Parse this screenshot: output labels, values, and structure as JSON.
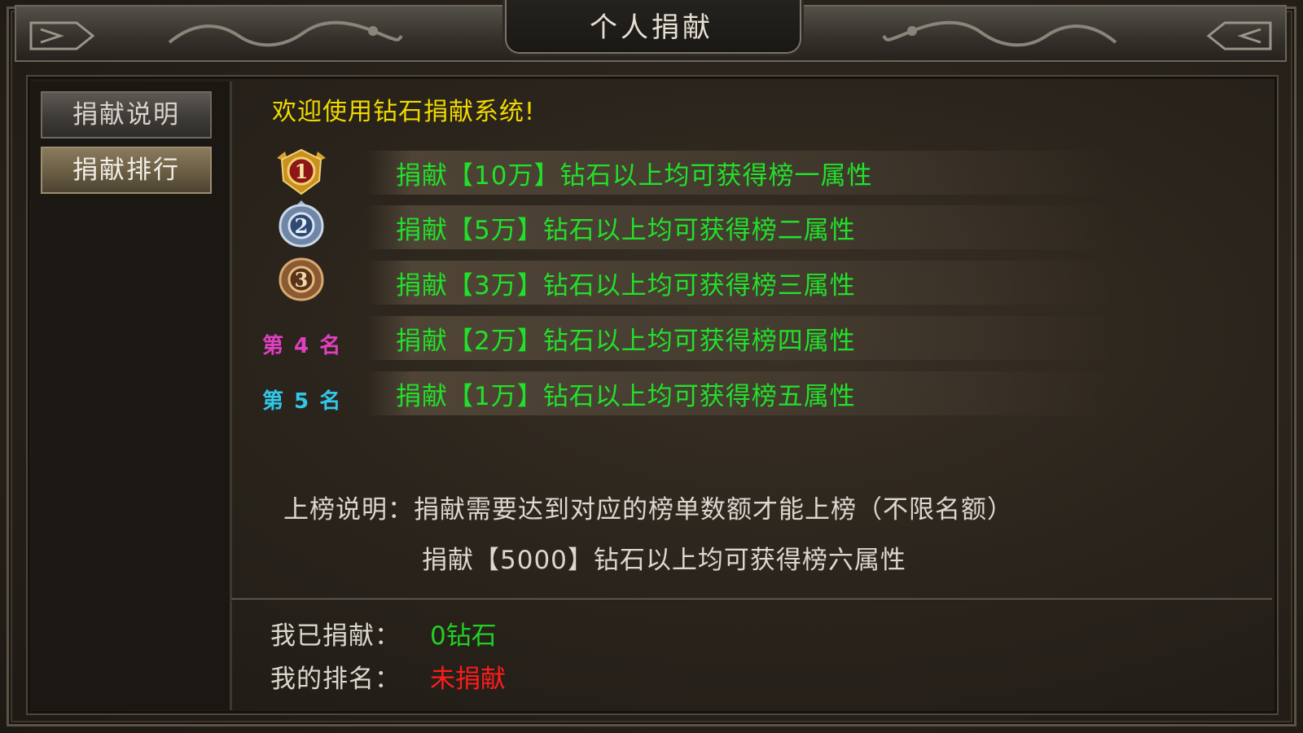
{
  "window": {
    "title": "个人捐献"
  },
  "sidebar": {
    "items": [
      {
        "label": "捐献说明",
        "active": false
      },
      {
        "label": "捐献排行",
        "active": true
      }
    ]
  },
  "main": {
    "welcome": "欢迎使用钻石捐献系统!",
    "tiers": [
      {
        "rank_badge": "1",
        "text": "捐献【10万】钻石以上均可获得榜一属性"
      },
      {
        "rank_badge": "2",
        "text": "捐献【5万】钻石以上均可获得榜二属性"
      },
      {
        "rank_badge": "3",
        "text": "捐献【3万】钻石以上均可获得榜三属性"
      },
      {
        "rank_label": "第 4 名",
        "text": "捐献【2万】钻石以上均可获得榜四属性"
      },
      {
        "rank_label": "第 5 名",
        "text": "捐献【1万】钻石以上均可获得榜五属性"
      }
    ],
    "note_line1": "上榜说明：捐献需要达到对应的榜单数额才能上榜（不限名额）",
    "note_line2": "捐献【5000】钻石以上均可获得榜六属性"
  },
  "footer": {
    "donated_label": "我已捐献：",
    "donated_value": "0钻石",
    "rank_label": "我的排名：",
    "rank_value": "未捐献"
  },
  "colors": {
    "tier_text": "#22e02a",
    "welcome": "#f0d900",
    "donated_value": "#22d022",
    "rank_value": "#ff1c1c",
    "rank4": "#e040c0",
    "rank5": "#30c8e8"
  },
  "icons": [
    "gold-medal-1-icon",
    "silver-medal-2-icon",
    "bronze-medal-3-icon",
    "dragon-ornament-icon"
  ]
}
